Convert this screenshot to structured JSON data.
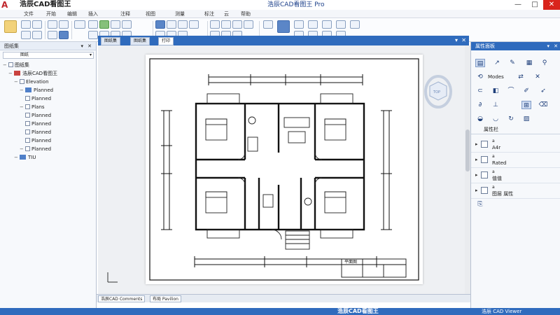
{
  "titlebar": {
    "app_title": "浩辰CAD看图王",
    "window_title": "浩辰CAD看图王 Pro",
    "logo_glyph": "A",
    "controls": [
      "—",
      "□",
      "✕"
    ]
  },
  "menubar": {
    "items": [
      "文件",
      "开始",
      "编辑",
      "插入",
      "注释",
      "视图",
      "测量",
      "标注",
      "云",
      "帮助"
    ]
  },
  "left_panel": {
    "title": "图纸集",
    "pin_glyph": "▾",
    "close_glyph": "✕",
    "combo_value": "图纸",
    "tree": [
      {
        "level": 0,
        "label": "图纸集",
        "folder": false,
        "toggle": "−"
      },
      {
        "level": 1,
        "label": "浩辰CAD看图王",
        "folder": true,
        "red": true,
        "toggle": "−"
      },
      {
        "level": 2,
        "label": "Elevation",
        "folder": false,
        "toggle": "−"
      },
      {
        "level": 3,
        "label": "Planned",
        "folder": true,
        "toggle": "−"
      },
      {
        "level": 3,
        "label": "Planned",
        "folder": false,
        "toggle": ""
      },
      {
        "level": 3,
        "label": "Plans",
        "folder": false,
        "toggle": "−"
      },
      {
        "level": 3,
        "label": "Planned",
        "folder": false,
        "toggle": ""
      },
      {
        "level": 3,
        "label": "Planned",
        "folder": false,
        "toggle": ""
      },
      {
        "level": 3,
        "label": "Planned",
        "folder": false,
        "toggle": ""
      },
      {
        "level": 3,
        "label": "Planned",
        "folder": false,
        "toggle": ""
      },
      {
        "level": 3,
        "label": "Planned",
        "folder": false,
        "toggle": "−"
      },
      {
        "level": 2,
        "label": "TIU",
        "folder": true,
        "toggle": "−"
      }
    ]
  },
  "document": {
    "tabs": [
      {
        "label": "图纸集"
      },
      {
        "label": "图纸集"
      },
      {
        "label": "打印",
        "active": true
      }
    ],
    "pin_glyph": "▾",
    "close_glyph": "✕",
    "viewcube_label": "TOP",
    "title_block_text": "平面图"
  },
  "layout_tabs": [
    {
      "label": "浩辰CAD Comments"
    },
    {
      "label": "布局 Pavilion"
    }
  ],
  "right_panel": {
    "title": "属性面板",
    "pin_glyph": "▾",
    "close_glyph": "✕",
    "section_label": "Modes",
    "props_header": "属性栏",
    "rows": [
      {
        "t1": "a",
        "t2": "A4r"
      },
      {
        "t1": "a",
        "t2": "Rated"
      },
      {
        "t1": "a",
        "t2": "值值"
      },
      {
        "t1": "a",
        "t2": "图层 属性"
      }
    ]
  },
  "statusbar": {
    "center_text": "浩辰CAD看图王",
    "right_text": "浩辰 CAD Viewer"
  },
  "colors": {
    "accent_blue": "#2f6bbd",
    "logo_red": "#c0262c"
  }
}
